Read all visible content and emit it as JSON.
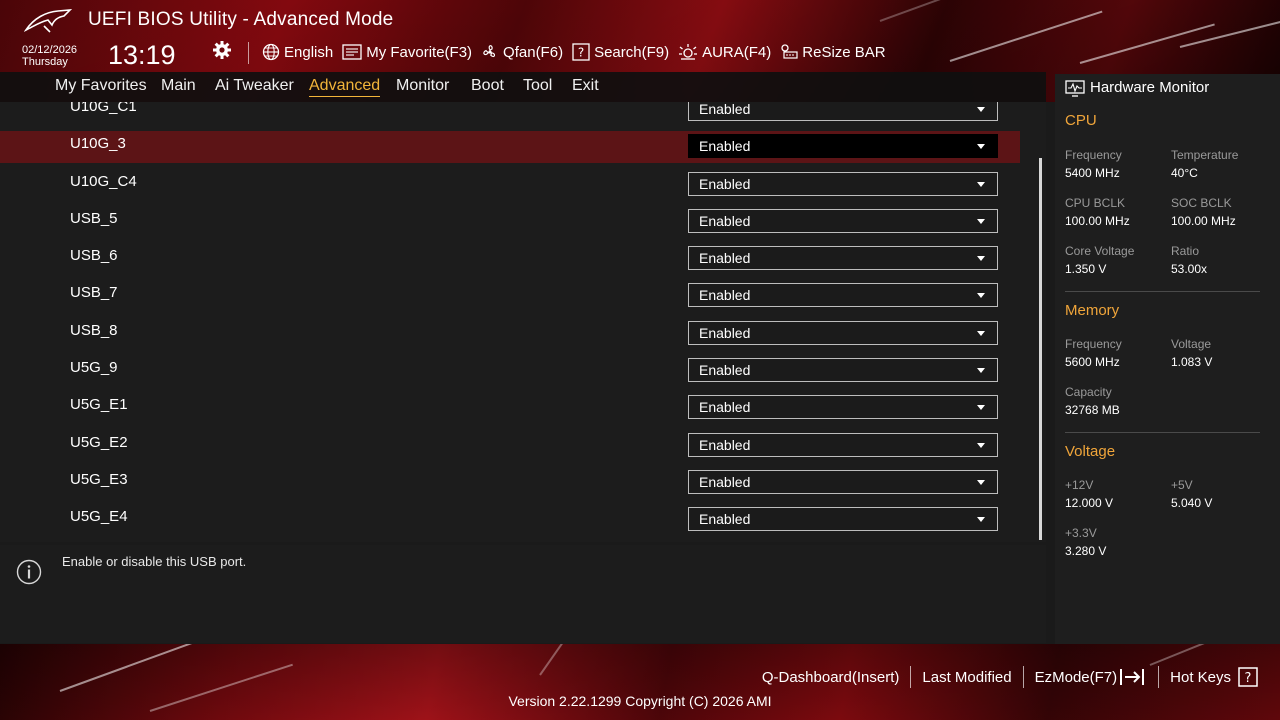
{
  "header": {
    "title": "UEFI BIOS Utility - Advanced Mode",
    "date": "02/12/2026",
    "day": "Thursday",
    "time": "13:19",
    "tools": [
      {
        "label": "English",
        "icon": "globe-icon"
      },
      {
        "label": "My Favorite(F3)",
        "icon": "favorite-list-icon"
      },
      {
        "label": "Qfan(F6)",
        "icon": "fan-icon"
      },
      {
        "label": "Search(F9)",
        "icon": "search-icon"
      },
      {
        "label": "AURA(F4)",
        "icon": "aura-light-icon"
      },
      {
        "label": "ReSize BAR",
        "icon": "resize-bar-icon"
      }
    ]
  },
  "tabs": [
    {
      "label": "My Favorites"
    },
    {
      "label": "Main"
    },
    {
      "label": "Ai Tweaker"
    },
    {
      "label": "Advanced",
      "active": true
    },
    {
      "label": "Monitor"
    },
    {
      "label": "Boot"
    },
    {
      "label": "Tool"
    },
    {
      "label": "Exit"
    }
  ],
  "settings": [
    {
      "label": "U10G_C1",
      "value": "Enabled"
    },
    {
      "label": "U10G_3",
      "value": "Enabled",
      "selected": true
    },
    {
      "label": "U10G_C4",
      "value": "Enabled"
    },
    {
      "label": "USB_5",
      "value": "Enabled"
    },
    {
      "label": "USB_6",
      "value": "Enabled"
    },
    {
      "label": "USB_7",
      "value": "Enabled"
    },
    {
      "label": "USB_8",
      "value": "Enabled"
    },
    {
      "label": "U5G_9",
      "value": "Enabled"
    },
    {
      "label": "U5G_E1",
      "value": "Enabled"
    },
    {
      "label": "U5G_E2",
      "value": "Enabled"
    },
    {
      "label": "U5G_E3",
      "value": "Enabled"
    },
    {
      "label": "U5G_E4",
      "value": "Enabled"
    }
  ],
  "help": {
    "text": "Enable or disable this USB port."
  },
  "hardware_monitor": {
    "title": "Hardware Monitor",
    "cpu": {
      "title": "CPU",
      "frequency_label": "Frequency",
      "frequency": "5400 MHz",
      "temperature_label": "Temperature",
      "temperature": "40°C",
      "cpu_bclk_label": "CPU BCLK",
      "cpu_bclk": "100.00 MHz",
      "soc_bclk_label": "SOC BCLK",
      "soc_bclk": "100.00 MHz",
      "core_voltage_label": "Core Voltage",
      "core_voltage": "1.350 V",
      "ratio_label": "Ratio",
      "ratio": "53.00x"
    },
    "memory": {
      "title": "Memory",
      "frequency_label": "Frequency",
      "frequency": "5600 MHz",
      "voltage_label": "Voltage",
      "voltage": "1.083 V",
      "capacity_label": "Capacity",
      "capacity": "32768 MB"
    },
    "voltage": {
      "title": "Voltage",
      "v12_label": "+12V",
      "v12": "12.000 V",
      "v5_label": "+5V",
      "v5": "5.040 V",
      "v33_label": "+3.3V",
      "v33": "3.280 V"
    }
  },
  "footer": {
    "q_dashboard": "Q-Dashboard(Insert)",
    "last_modified": "Last Modified",
    "ezmode": "EzMode(F7)",
    "hot_keys": "Hot Keys",
    "version": "Version 2.22.1299 Copyright (C) 2026 AMI"
  },
  "colors": {
    "accent": "#f2b53a",
    "section_title": "#f0a53a",
    "selected_row": "#5c1416",
    "brand_red": "#a50f15"
  }
}
